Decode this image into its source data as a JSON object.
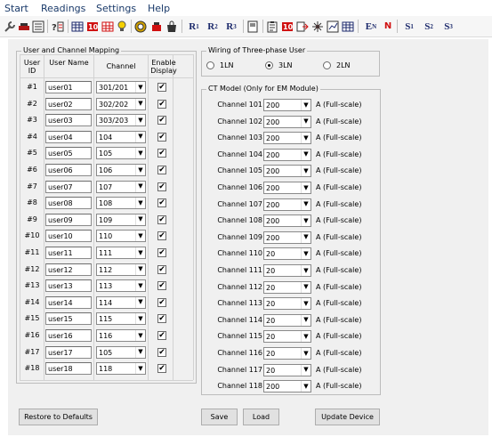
{
  "menu": [
    "Start",
    "Readings",
    "Settings",
    "Help"
  ],
  "toolbar": {
    "icons": [
      "wrench-icon",
      "cable-icon",
      "list-icon",
      "help-icon",
      "table-icon",
      "ten-icon",
      "grid-red-icon",
      "bulb-icon",
      "target-icon",
      "pot-icon",
      "bag-icon"
    ],
    "r_buttons": [
      [
        "R",
        "1"
      ],
      [
        "R",
        "2"
      ],
      [
        "R",
        "3"
      ]
    ],
    "icons2": [
      "device-icon",
      "clipboard-icon",
      "ten-doc-icon",
      "arrow-doc-icon",
      "network-icon",
      "chart-icon",
      "grid-icon"
    ],
    "en_label": [
      "E",
      "N"
    ],
    "n_label": "N",
    "s_buttons": [
      [
        "S",
        "1"
      ],
      [
        "S",
        "2"
      ],
      [
        "S",
        "3"
      ]
    ]
  },
  "mapping": {
    "title": "User and Channel Mapping",
    "headers": {
      "user_id": "User ID",
      "user_name": "User Name",
      "channel": "Channel",
      "enable": "Enable Display"
    },
    "rows": [
      {
        "id": "#1",
        "name": "user01",
        "channel": "301/201",
        "enabled": "✔"
      },
      {
        "id": "#2",
        "name": "user02",
        "channel": "302/202",
        "enabled": "✔"
      },
      {
        "id": "#3",
        "name": "user03",
        "channel": "303/203",
        "enabled": "✔"
      },
      {
        "id": "#4",
        "name": "user04",
        "channel": "104",
        "enabled": "✔"
      },
      {
        "id": "#5",
        "name": "user05",
        "channel": "105",
        "enabled": "✔"
      },
      {
        "id": "#6",
        "name": "user06",
        "channel": "106",
        "enabled": "✔"
      },
      {
        "id": "#7",
        "name": "user07",
        "channel": "107",
        "enabled": "✔"
      },
      {
        "id": "#8",
        "name": "user08",
        "channel": "108",
        "enabled": "✔"
      },
      {
        "id": "#9",
        "name": "user09",
        "channel": "109",
        "enabled": "✔"
      },
      {
        "id": "#10",
        "name": "user10",
        "channel": "110",
        "enabled": "✔"
      },
      {
        "id": "#11",
        "name": "user11",
        "channel": "111",
        "enabled": "✔"
      },
      {
        "id": "#12",
        "name": "user12",
        "channel": "112",
        "enabled": "✔"
      },
      {
        "id": "#13",
        "name": "user13",
        "channel": "113",
        "enabled": "✔"
      },
      {
        "id": "#14",
        "name": "user14",
        "channel": "114",
        "enabled": "✔"
      },
      {
        "id": "#15",
        "name": "user15",
        "channel": "115",
        "enabled": "✔"
      },
      {
        "id": "#16",
        "name": "user16",
        "channel": "116",
        "enabled": "✔"
      },
      {
        "id": "#17",
        "name": "user17",
        "channel": "105",
        "enabled": "✔"
      },
      {
        "id": "#18",
        "name": "user18",
        "channel": "118",
        "enabled": "✔"
      }
    ]
  },
  "wiring": {
    "title": "Wiring of Three-phase User",
    "options": [
      {
        "label": "1LN",
        "selected": false
      },
      {
        "label": "3LN",
        "selected": true
      },
      {
        "label": "2LN",
        "selected": false
      }
    ]
  },
  "ct": {
    "title": "CT Model (Only for EM Module)",
    "unit": "A (Full-scale)",
    "rows": [
      {
        "label": "Channel 101",
        "value": "200"
      },
      {
        "label": "Channel 102",
        "value": "200"
      },
      {
        "label": "Channel 103",
        "value": "200"
      },
      {
        "label": "Channel 104",
        "value": "200"
      },
      {
        "label": "Channel 105",
        "value": "200"
      },
      {
        "label": "Channel 106",
        "value": "200"
      },
      {
        "label": "Channel 107",
        "value": "200"
      },
      {
        "label": "Channel 108",
        "value": "200"
      },
      {
        "label": "Channel 109",
        "value": "200"
      },
      {
        "label": "Channel 110",
        "value": "20"
      },
      {
        "label": "Channel 111",
        "value": "20"
      },
      {
        "label": "Channel 112",
        "value": "20"
      },
      {
        "label": "Channel 113",
        "value": "20"
      },
      {
        "label": "Channel 114",
        "value": "20"
      },
      {
        "label": "Channel 115",
        "value": "20"
      },
      {
        "label": "Channel 116",
        "value": "20"
      },
      {
        "label": "Channel 117",
        "value": "20"
      },
      {
        "label": "Channel 118",
        "value": "200"
      }
    ]
  },
  "buttons": {
    "restore": "Restore to Defaults",
    "save": "Save",
    "load": "Load",
    "update": "Update Device"
  }
}
